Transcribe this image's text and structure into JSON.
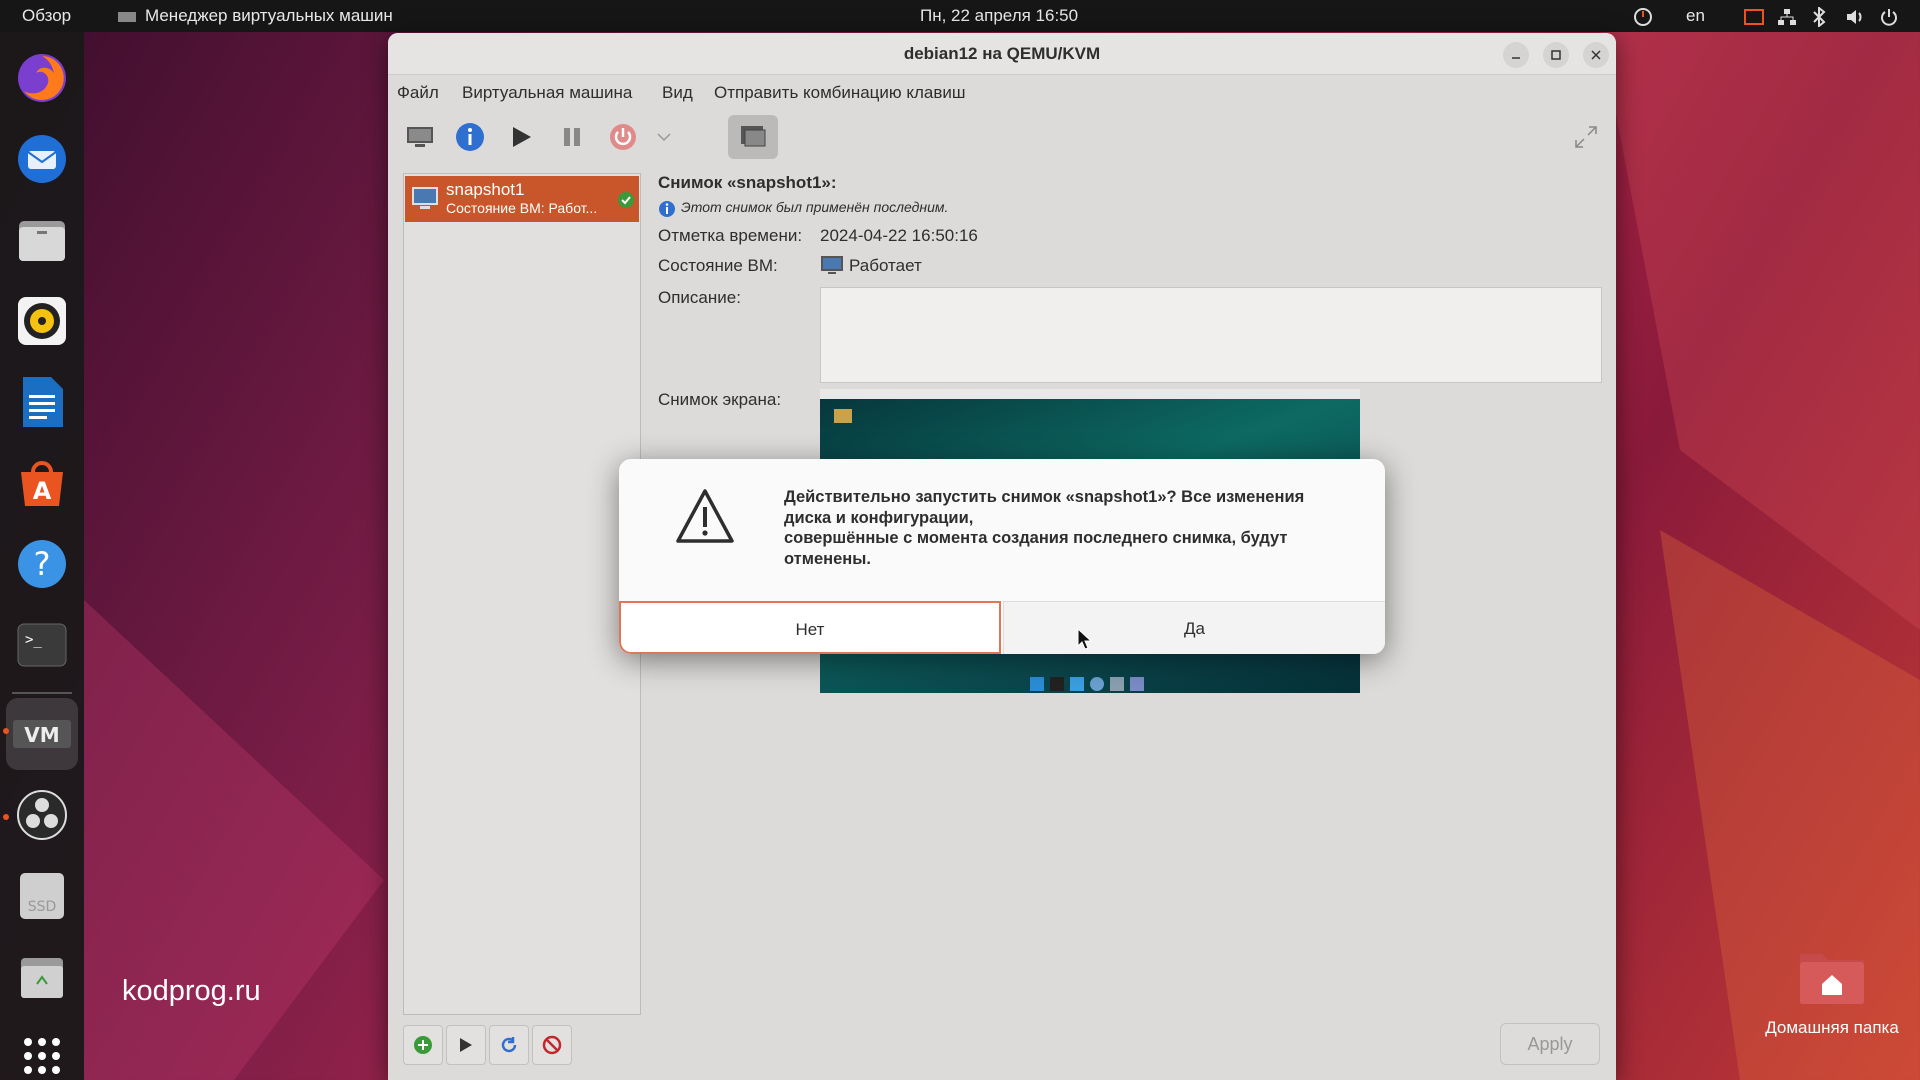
{
  "topbar": {
    "overview": "Обзор",
    "app_name": "Менеджер виртуальных машин",
    "datetime": "Пн, 22 апреля  16:50",
    "lang": "en"
  },
  "window": {
    "title": "debian12 на QEMU/KVM",
    "menu": [
      "Файл",
      "Виртуальная машина",
      "Вид",
      "Отправить комбинацию клавиш"
    ]
  },
  "snapshots": {
    "items": [
      {
        "name": "snapshot1",
        "state": "Состояние ВМ: Работ..."
      }
    ]
  },
  "details": {
    "heading": "Снимок «snapshot1»:",
    "info_note": "Этот снимок был применён последним.",
    "timestamp_label": "Отметка времени:",
    "timestamp_value": "2024-04-22 16:50:16",
    "state_label": "Состояние ВМ:",
    "state_value": "Работает",
    "description_label": "Описание:",
    "description_value": "",
    "screenshot_label": "Снимок экрана:"
  },
  "dialog": {
    "message": "Действительно запустить снимок «snapshot1»? Все изменения диска и конфигурации,\nсовершённые с момента создания последнего снимка, будут отменены.",
    "no_label": "Нет",
    "yes_label": "Да"
  },
  "bottom": {
    "apply_label": "Apply"
  },
  "desktop": {
    "watermark": "kodprog.ru",
    "home_folder": "Домашняя папка",
    "ssd_label": "SSD"
  },
  "colors": {
    "accent": "#e95420",
    "selection": "#c9562a",
    "dialog_focus": "#e07656"
  }
}
